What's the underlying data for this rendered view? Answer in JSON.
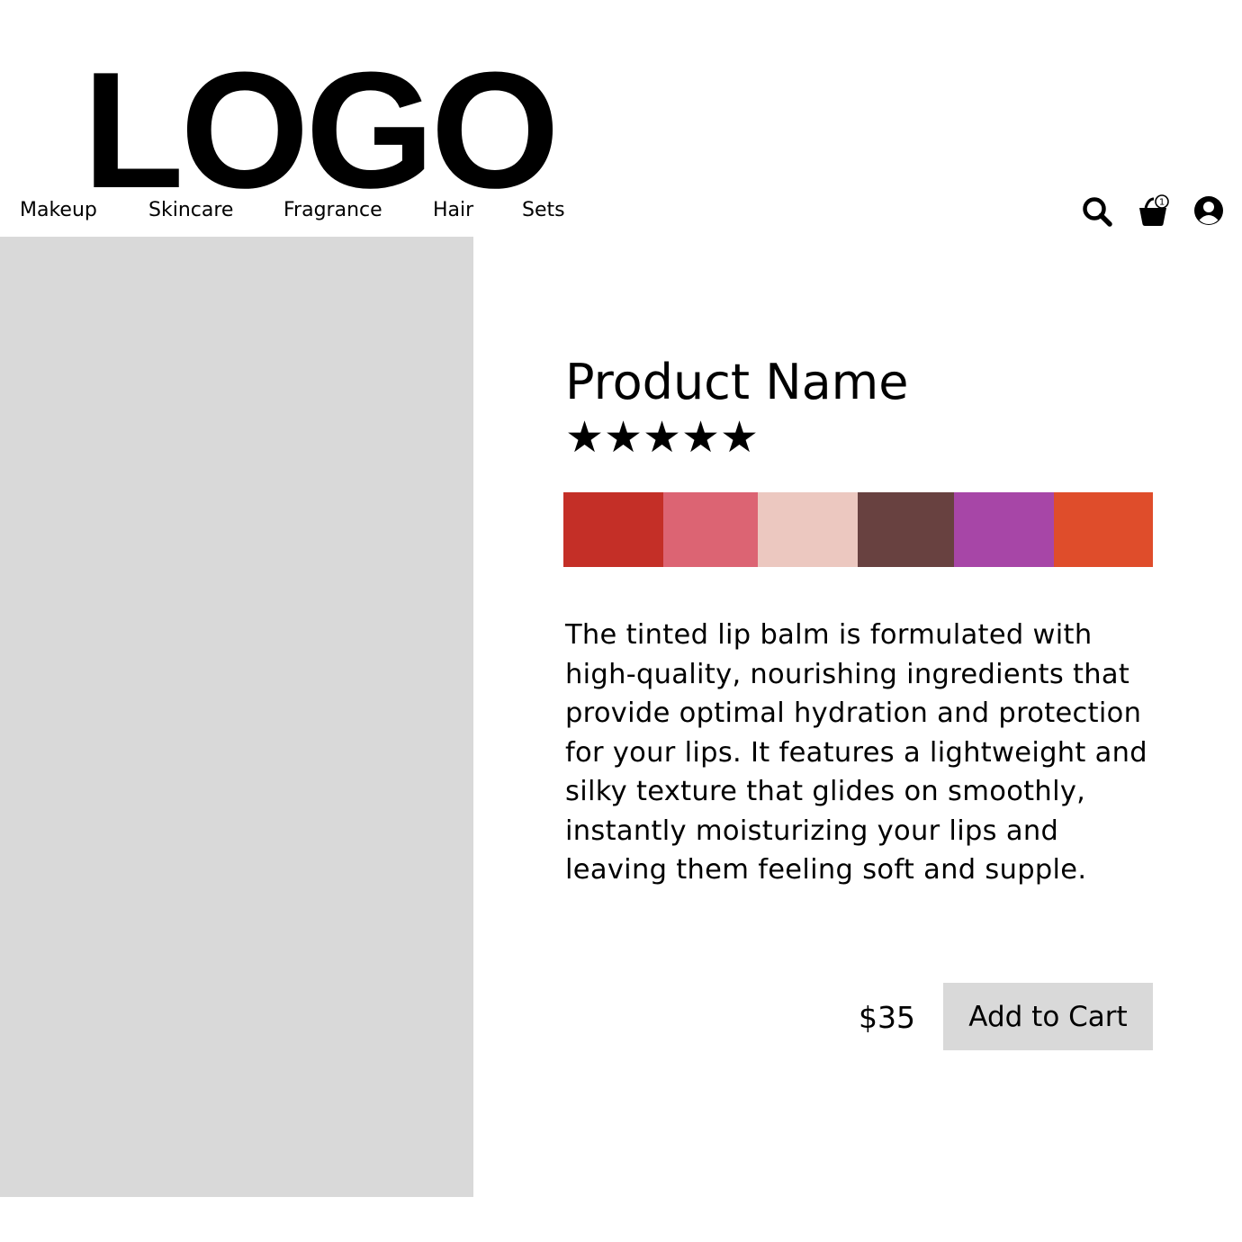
{
  "logo": {
    "text": "LOGO"
  },
  "nav": {
    "items": [
      {
        "label": "Makeup"
      },
      {
        "label": "Skincare"
      },
      {
        "label": "Fragrance"
      },
      {
        "label": "Hair"
      },
      {
        "label": "Sets"
      }
    ]
  },
  "header_icons": {
    "search": "search-icon",
    "cart": "shopping-basket-icon",
    "cart_count": "1",
    "account": "user-account-icon"
  },
  "product": {
    "name": "Product Name",
    "rating": {
      "value": 5,
      "max": 5,
      "star_glyph": "★"
    },
    "swatches": [
      "#c42f27",
      "#dc6473",
      "#ecc8c0",
      "#684140",
      "#a746a7",
      "#df4d2b"
    ],
    "description": "The tinted lip balm is formulated with high-quality, nourishing ingredients that provide optimal hydration and protection for your lips. It features a lightweight and silky texture that glides on smoothly, instantly moisturizing your lips and leaving them feeling soft and supple.",
    "price": "$35",
    "add_to_cart_label": "Add to Cart",
    "image_placeholder_color": "#d9d9d9"
  }
}
